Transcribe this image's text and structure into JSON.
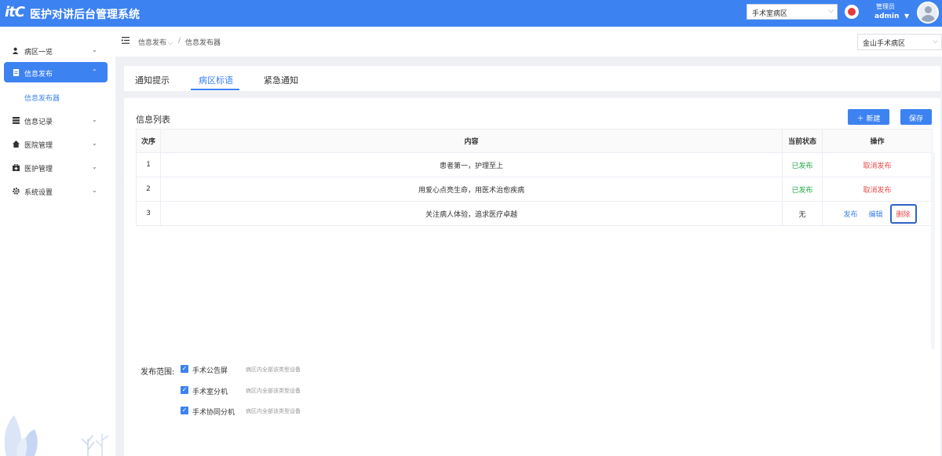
{
  "header": {
    "logo": "itC",
    "title": "医护对讲后台管理系统",
    "ward_select": "手术室病区",
    "user_role": "管理员",
    "user_name": "admin"
  },
  "sidebar": {
    "items": [
      {
        "label": "病区一览",
        "icon": "user-icon"
      },
      {
        "label": "信息发布",
        "icon": "document-icon",
        "active": true
      },
      {
        "label": "信息记录",
        "icon": "list-icon"
      },
      {
        "label": "医院管理",
        "icon": "home-icon"
      },
      {
        "label": "医护管理",
        "icon": "medical-kit-icon"
      },
      {
        "label": "系统设置",
        "icon": "gear-icon"
      }
    ],
    "sub_item": "信息发布器"
  },
  "breadcrumb": {
    "level1": "信息发布",
    "level2": "信息发布器",
    "area_select": "金山手术病区"
  },
  "tabs": [
    "通知提示",
    "病区标语",
    "紧急通知"
  ],
  "active_tab": "病区标语",
  "list": {
    "title": "信息列表",
    "new_label": "新建",
    "save_label": "保存",
    "columns": [
      "次序",
      "内容",
      "当前状态",
      "操作"
    ],
    "rows": [
      {
        "index": "1",
        "content": "患者第一，护理至上",
        "status": "已发布",
        "op_cancel": "取消发布"
      },
      {
        "index": "2",
        "content": "用爱心点亮生命，用医术治愈疾病",
        "status": "已发布",
        "op_cancel": "取消发布"
      },
      {
        "index": "3",
        "content": "关注病人体验，追求医疗卓越",
        "status": "无",
        "op_publish": "发布",
        "op_edit": "编辑",
        "op_delete": "删除"
      }
    ]
  },
  "scope": {
    "label": "发布范围:",
    "options": [
      {
        "label": "手术公告屏",
        "desc": "病区内全部该类型设备",
        "checked": true
      },
      {
        "label": "手术室分机",
        "desc": "病区内全部该类型设备",
        "checked": true
      },
      {
        "label": "手术协同分机",
        "desc": "病区内全部该类型设备",
        "checked": true
      }
    ]
  },
  "colors": {
    "primary": "#3d82f1",
    "status_published": "#22a84a",
    "danger": "#e84b4b"
  }
}
